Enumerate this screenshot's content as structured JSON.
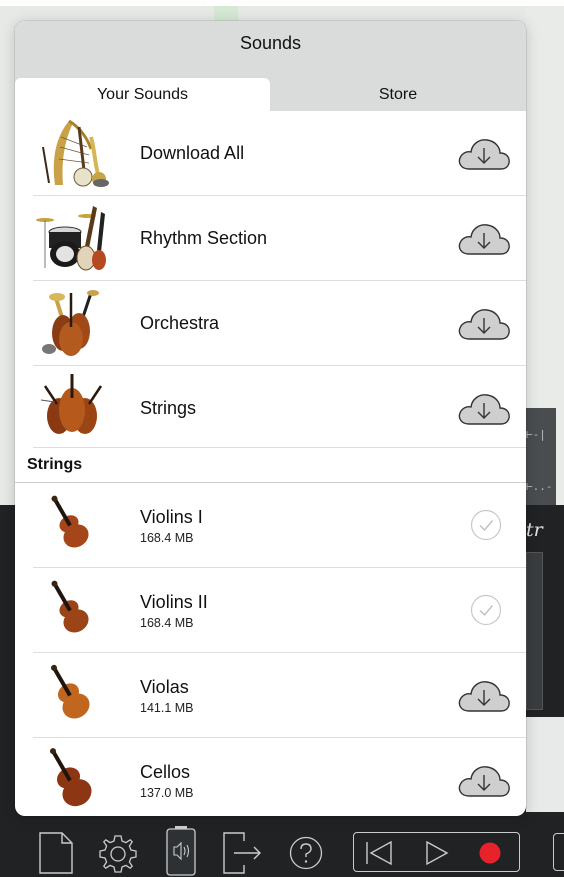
{
  "popover": {
    "title": "Sounds",
    "tabs": [
      {
        "label": "Your Sounds",
        "selected": true
      },
      {
        "label": "Store",
        "selected": false
      }
    ]
  },
  "sound_sets": [
    {
      "title": "Download All",
      "icon": "instruments-collage-icon",
      "status": "cloud-download-icon"
    },
    {
      "title": "Rhythm Section",
      "icon": "drums-guitar-icon",
      "status": "cloud-download-icon"
    },
    {
      "title": "Orchestra",
      "icon": "orchestra-instruments-icon",
      "status": "cloud-download-icon"
    },
    {
      "title": "Strings",
      "icon": "string-instruments-icon",
      "status": "cloud-download-icon"
    }
  ],
  "section": {
    "title": "Strings",
    "items": [
      {
        "title": "Violins I",
        "size": "168.4 MB",
        "status": "checkmark-icon"
      },
      {
        "title": "Violins II",
        "size": "168.4 MB",
        "status": "checkmark-icon"
      },
      {
        "title": "Violas",
        "size": "141.1 MB",
        "status": "cloud-download-icon"
      },
      {
        "title": "Cellos",
        "size": "137.0 MB",
        "status": "cloud-download-icon"
      }
    ]
  },
  "background": {
    "score_marker": "tr"
  },
  "toolbar": {
    "icons": [
      "new-document-icon",
      "settings-gear-icon",
      "sounds-speaker-icon",
      "export-icon",
      "help-icon",
      "rewind-icon",
      "play-icon",
      "record-icon"
    ]
  },
  "colors": {
    "header_gray": "#d9dcdb",
    "record_red": "#e8222a",
    "toolbar_bg": "#202224"
  }
}
